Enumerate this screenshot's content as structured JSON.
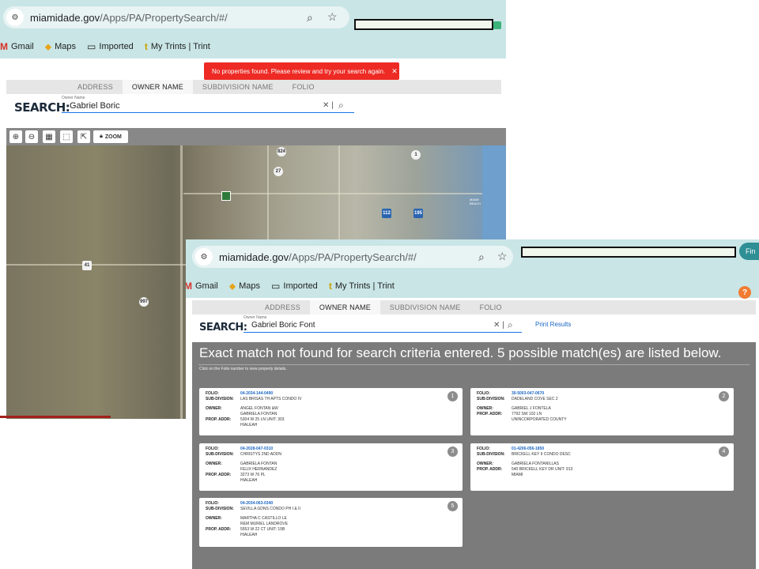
{
  "browser": {
    "url_domain": "miamidade.gov",
    "url_path": "/Apps/PA/PropertySearch/#/",
    "bookmarks": [
      "Gmail",
      "Maps",
      "Imported",
      "My Trints | Trint"
    ],
    "window2_right_button": "Fin"
  },
  "tabs": [
    "ADDRESS",
    "OWNER NAME",
    "SUBDIVISION NAME",
    "FOLIO"
  ],
  "search_label": "SEARCH:",
  "field_caption": "Owner Name",
  "window1": {
    "owner_value": "Gabriel Boric",
    "toast": "No properties found. Please review and try your search again.",
    "toolbar_zoom": "ZOOM",
    "map_labels": [
      "824",
      "27",
      "41",
      "997",
      "MIAMI BEACH",
      "112",
      "195",
      "1"
    ]
  },
  "window2": {
    "owner_value": "Gabriel Boric Font",
    "print_results": "Print Results",
    "results_title": "Exact match not found for search criteria entered.   5 possible match(es) are listed below.",
    "results_hint": "Click on the Folio number to view property details.",
    "labels": {
      "folio": "FOLIO:",
      "subdivision": "SUB-DIVISION:",
      "owner": "OWNER:",
      "prop_addr": "PROP. ADDR:"
    },
    "cards": [
      {
        "num": "1",
        "folio": "04-2034-144-0490",
        "subdivision": "LAS BRISAS TH APTS CONDO IV",
        "owner1": "ANGEL FONTAN &W",
        "owner2": "GABRIELA FONTAN",
        "addr1": "5304 W 25 LN    UNIT: 303",
        "addr2": "HIALEAH"
      },
      {
        "num": "2",
        "folio": "30-5003-047-0670",
        "subdivision": "DADELAND COVE SEC 2",
        "owner1": "GABRIEL J FONTELA",
        "owner2": "",
        "addr1": "7792 SW 102 LN",
        "addr2": "UNINCORPORATED COUNTY"
      },
      {
        "num": "3",
        "folio": "04-2028-047-0310",
        "subdivision": "CHRISTYS 2ND ADDN",
        "owner1": "GABRIELA FONTAN",
        "owner2": "FELIX HERNANDEZ",
        "addr1": "3273 W 76 PL",
        "addr2": "HIALEAH"
      },
      {
        "num": "4",
        "folio": "01-4206-056-1850",
        "subdivision": "BRICKELL KEY II CONDO DESC",
        "owner1": "GABRIELA FONTANILLAS",
        "owner2": "",
        "addr1": "540 BRICKELL KEY DR    UNIT: 913",
        "addr2": "MIAMI"
      },
      {
        "num": "5",
        "folio": "04-2034-063-0340",
        "subdivision": "SEVILLA GDNS CONDO PH I & II",
        "owner1": "MARTHA C CASTILLO LE",
        "owner2": "REM MURIEL LANDROVE",
        "addr1": "5553 W 22 CT    UNIT: 15B",
        "addr2": "HIALEAH"
      }
    ]
  }
}
